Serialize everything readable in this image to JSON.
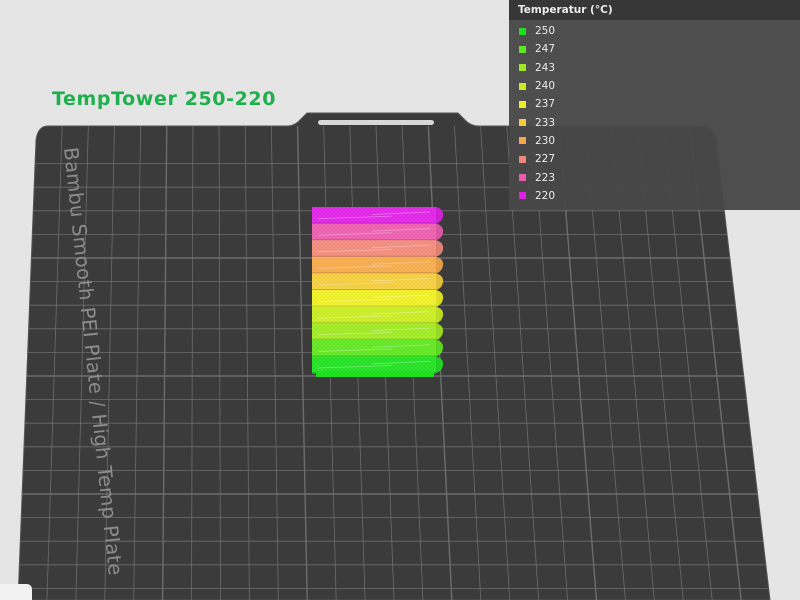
{
  "plate": {
    "title": "TempTower 250-220",
    "bed_label": "Bambu Smooth PEI Plate / High Temp Plate"
  },
  "legend": {
    "title": "Temperatur (°C)",
    "items": [
      {
        "label": "250",
        "color": "#1ee01e"
      },
      {
        "label": "247",
        "color": "#5ee61e"
      },
      {
        "label": "243",
        "color": "#9ee91e"
      },
      {
        "label": "240",
        "color": "#c8ec1e"
      },
      {
        "label": "237",
        "color": "#eeee22"
      },
      {
        "label": "233",
        "color": "#f2cc3a"
      },
      {
        "label": "230",
        "color": "#f5a848"
      },
      {
        "label": "227",
        "color": "#f08878"
      },
      {
        "label": "223",
        "color": "#ec5aac"
      },
      {
        "label": "220",
        "color": "#e01ee6"
      }
    ]
  },
  "colors": {
    "background": "#e4e5e4",
    "bed": "#3b3b3c",
    "grid": "#6c6c6e",
    "title": "#1fb04d"
  }
}
